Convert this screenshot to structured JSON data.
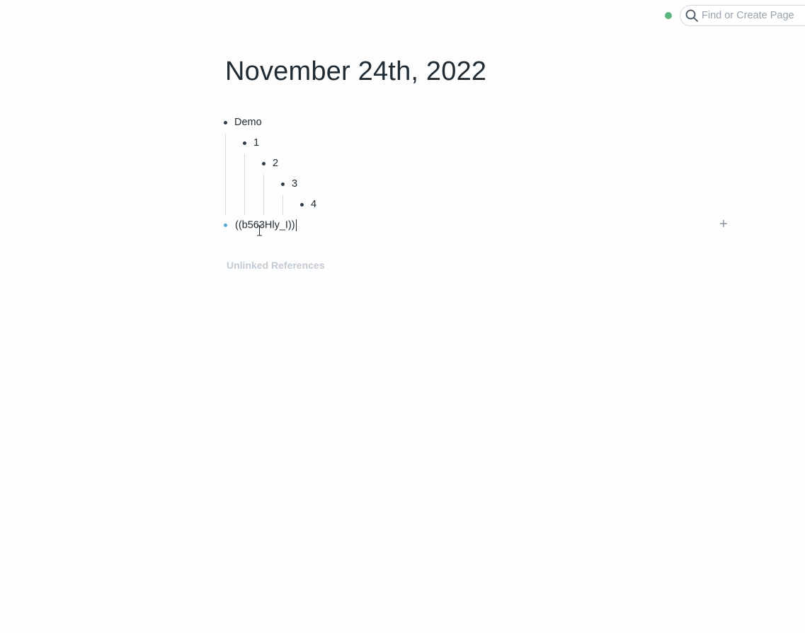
{
  "topbar": {
    "sync_status_color": "#5bb47c",
    "search": {
      "placeholder": "Find or Create Page",
      "value": "",
      "icon": "search-icon"
    }
  },
  "page": {
    "title": "November 24th, 2022"
  },
  "blocks": [
    {
      "text": "Demo",
      "depth": 0
    },
    {
      "text": "1",
      "depth": 1
    },
    {
      "text": "2",
      "depth": 2
    },
    {
      "text": "3",
      "depth": 3
    },
    {
      "text": "4",
      "depth": 4
    },
    {
      "text": "((b563Hly_I))",
      "depth": 0,
      "editing": true
    }
  ],
  "add_block_label": "+",
  "unlinked_references_label": "Unlinked References"
}
